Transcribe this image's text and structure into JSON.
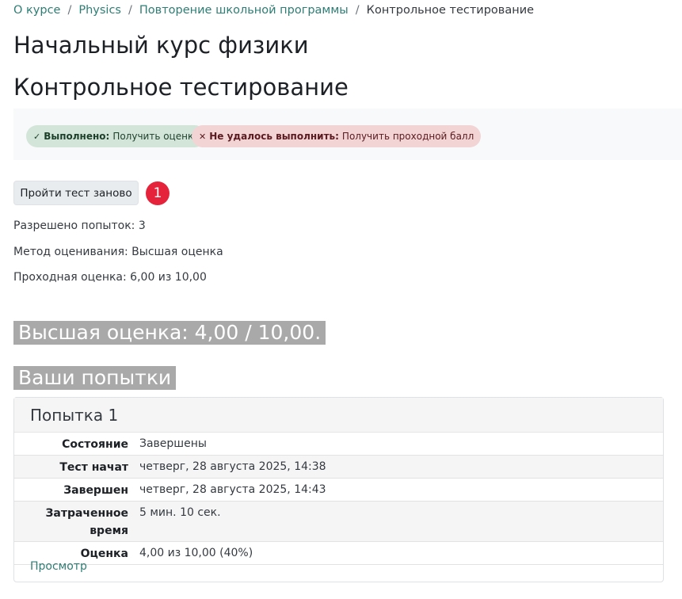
{
  "breadcrumb": {
    "items": [
      "О курсе",
      "Physics",
      "Повторение школьной программы"
    ],
    "current": "Контрольное тестирование",
    "separator": "/"
  },
  "course_title": "Начальный курс физики",
  "activity_title": "Контрольное тестирование",
  "completion": {
    "done": {
      "status": "Выполнено:",
      "text": "Получить оценку",
      "icon": "check-icon"
    },
    "failed": {
      "status": "Не удалось выполнить:",
      "text": "Получить проходной балл",
      "icon": "cross-icon"
    }
  },
  "retry_button": "Пройти тест заново",
  "step_marker": "1",
  "info": {
    "attempts_allowed": "Разрешено попыток: 3",
    "grading_method": "Метод оценивания: Высшая оценка",
    "passing_grade": "Проходная оценка: 6,00 из 10,00"
  },
  "best_grade": "Высшая оценка: 4,00 / 10,00.",
  "your_attempts": "Ваши попытки",
  "attempt": {
    "title": "Попытка 1",
    "rows": [
      {
        "label": "Состояние",
        "value": "Завершены"
      },
      {
        "label": "Тест начат",
        "value": "четверг, 28 августа 2025, 14:38"
      },
      {
        "label": "Завершен",
        "value": "четверг, 28 августа 2025, 14:43"
      },
      {
        "label": "Затраченное время",
        "value": "5 мин. 10 сек."
      },
      {
        "label": "Оценка",
        "value": "4,00 из 10,00 (40%)"
      }
    ],
    "review_link": "Просмотр"
  },
  "colors": {
    "link": "#2d7e74",
    "badge_done_bg": "#d3e5d9",
    "badge_fail_bg": "#f2d4d5",
    "marker": "#e5243b",
    "highlight": "#a9a9a9"
  }
}
